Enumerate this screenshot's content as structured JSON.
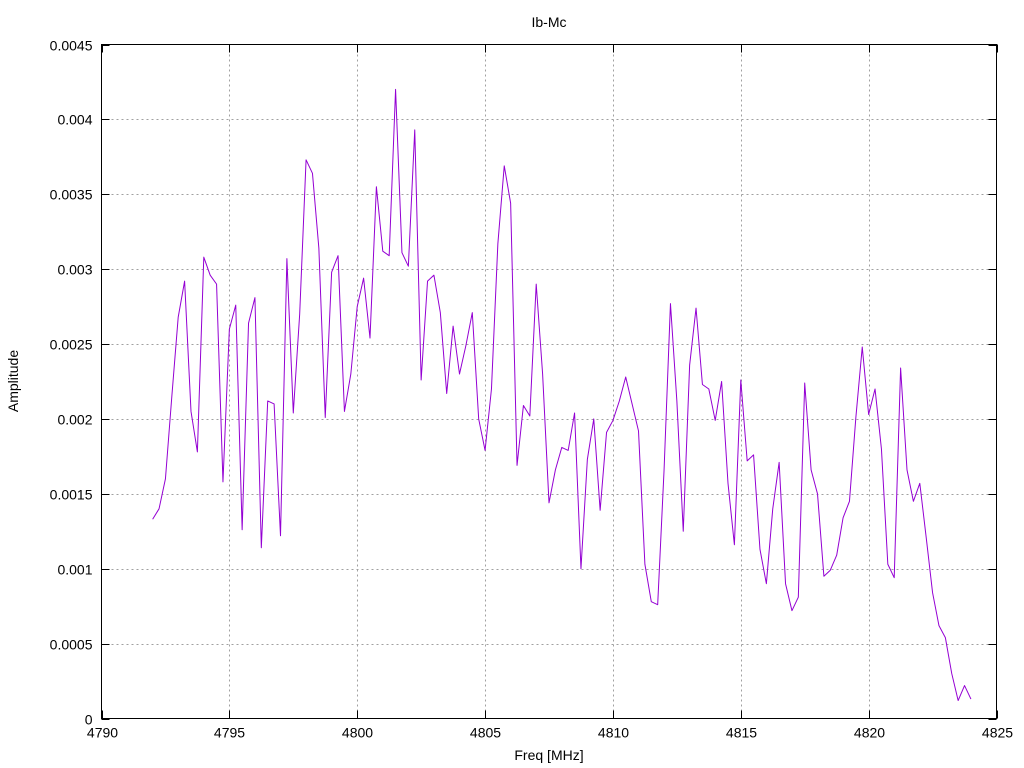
{
  "chart_data": {
    "type": "line",
    "title": "Ib-Mc",
    "xlabel": "Freq [MHz]",
    "ylabel": "Amplitude",
    "xlim": [
      4790,
      4825
    ],
    "ylim": [
      0,
      0.0045
    ],
    "xticks": [
      4790,
      4795,
      4800,
      4805,
      4810,
      4815,
      4820,
      4825
    ],
    "yticks": [
      "0",
      "0.0005",
      "0.001",
      "0.0015",
      "0.002",
      "0.0025",
      "0.003",
      "0.0035",
      "0.004",
      "0.0045"
    ],
    "grid": true,
    "legend": "none",
    "series": [
      {
        "color": "#9400d3",
        "x": [
          4792.0,
          4792.25,
          4792.5,
          4792.75,
          4793.0,
          4793.25,
          4793.5,
          4793.75,
          4794.0,
          4794.25,
          4794.5,
          4794.75,
          4795.0,
          4795.25,
          4795.5,
          4795.75,
          4796.0,
          4796.25,
          4796.5,
          4796.75,
          4797.0,
          4797.25,
          4797.5,
          4797.75,
          4798.0,
          4798.25,
          4798.5,
          4798.75,
          4799.0,
          4799.25,
          4799.5,
          4799.75,
          4800.0,
          4800.25,
          4800.5,
          4800.75,
          4801.0,
          4801.25,
          4801.5,
          4801.75,
          4802.0,
          4802.25,
          4802.5,
          4802.75,
          4803.0,
          4803.25,
          4803.5,
          4803.75,
          4804.0,
          4804.25,
          4804.5,
          4804.75,
          4805.0,
          4805.25,
          4805.5,
          4805.75,
          4806.0,
          4806.25,
          4806.5,
          4806.75,
          4807.0,
          4807.25,
          4807.5,
          4807.75,
          4808.0,
          4808.25,
          4808.5,
          4808.75,
          4809.0,
          4809.25,
          4809.5,
          4809.75,
          4810.0,
          4810.25,
          4810.5,
          4810.75,
          4811.0,
          4811.25,
          4811.5,
          4811.75,
          4812.0,
          4812.25,
          4812.5,
          4812.75,
          4813.0,
          4813.25,
          4813.5,
          4813.75,
          4814.0,
          4814.25,
          4814.5,
          4814.75,
          4815.0,
          4815.25,
          4815.5,
          4815.75,
          4816.0,
          4816.25,
          4816.5,
          4816.75,
          4817.0,
          4817.25,
          4817.5,
          4817.75,
          4818.0,
          4818.25,
          4818.5,
          4818.75,
          4819.0,
          4819.25,
          4819.5,
          4819.75,
          4820.0,
          4820.25,
          4820.5,
          4820.75,
          4821.0,
          4821.25,
          4821.5,
          4821.75,
          4822.0,
          4822.25,
          4822.5,
          4822.75,
          4823.0,
          4823.25,
          4823.5,
          4823.75,
          4824.0
        ],
        "y": [
          0.00133,
          0.0014,
          0.0016,
          0.00215,
          0.00268,
          0.00292,
          0.00205,
          0.00178,
          0.00308,
          0.00296,
          0.0029,
          0.00158,
          0.0026,
          0.00276,
          0.00126,
          0.00264,
          0.00281,
          0.00114,
          0.00212,
          0.0021,
          0.00122,
          0.00307,
          0.00204,
          0.0027,
          0.00373,
          0.00364,
          0.00314,
          0.00201,
          0.00298,
          0.00309,
          0.00205,
          0.0023,
          0.00275,
          0.00294,
          0.00254,
          0.00355,
          0.00312,
          0.00309,
          0.0042,
          0.00311,
          0.00302,
          0.00393,
          0.00226,
          0.00292,
          0.00296,
          0.00271,
          0.00217,
          0.00262,
          0.0023,
          0.00249,
          0.00271,
          0.002,
          0.00179,
          0.0022,
          0.00317,
          0.00369,
          0.00344,
          0.00169,
          0.00209,
          0.00202,
          0.0029,
          0.0023,
          0.00144,
          0.00166,
          0.00181,
          0.00179,
          0.00204,
          0.001,
          0.00173,
          0.002,
          0.00139,
          0.00191,
          0.00199,
          0.00212,
          0.00228,
          0.0021,
          0.00192,
          0.00103,
          0.00078,
          0.00076,
          0.00166,
          0.00277,
          0.00212,
          0.00125,
          0.00236,
          0.00274,
          0.00223,
          0.0022,
          0.00199,
          0.00225,
          0.00157,
          0.00116,
          0.00226,
          0.00172,
          0.00176,
          0.00113,
          0.0009,
          0.0014,
          0.00171,
          0.0009,
          0.00072,
          0.00081,
          0.00224,
          0.00166,
          0.0015,
          0.00095,
          0.00099,
          0.00109,
          0.00134,
          0.00145,
          0.00201,
          0.00248,
          0.00203,
          0.0022,
          0.0018,
          0.00103,
          0.00094,
          0.00234,
          0.00166,
          0.00145,
          0.00157,
          0.00121,
          0.00084,
          0.00062,
          0.00054,
          0.0003,
          0.00012,
          0.00022,
          0.00013
        ]
      }
    ]
  }
}
